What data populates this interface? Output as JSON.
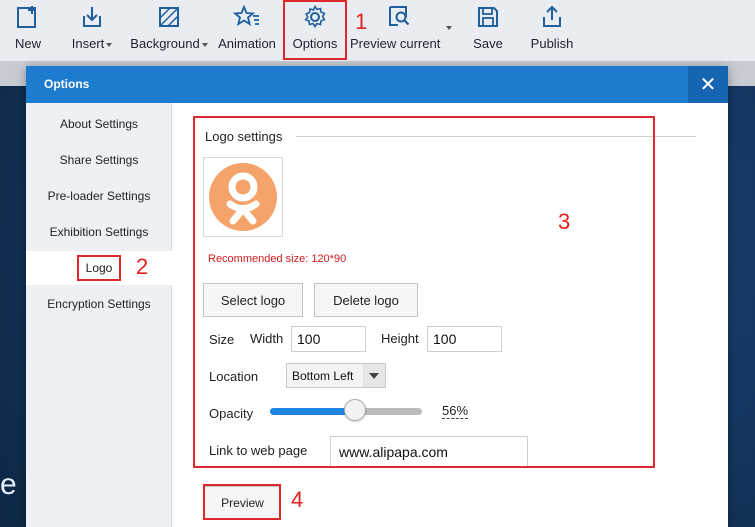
{
  "toolbar": {
    "items": [
      {
        "label": "New",
        "icon": "new-page-icon"
      },
      {
        "label": "Insert",
        "icon": "insert-icon",
        "dropdown": true
      },
      {
        "label": "Background",
        "icon": "background-icon",
        "dropdown": true
      },
      {
        "label": "Animation",
        "icon": "animation-icon"
      },
      {
        "label": "Options",
        "icon": "gear-icon"
      },
      {
        "label": "Preview current",
        "icon": "preview-search-icon",
        "dropdown": true
      },
      {
        "label": "Save",
        "icon": "save-icon"
      },
      {
        "label": "Publish",
        "icon": "publish-icon"
      }
    ]
  },
  "annotations": {
    "n1": "1",
    "n2": "2",
    "n3": "3",
    "n4": "4",
    "color": "#e0282c"
  },
  "dialog": {
    "title": "Options",
    "close_label": "✕",
    "header_color": "#1d7bd0"
  },
  "sidebar": {
    "items": [
      {
        "label": "About Settings"
      },
      {
        "label": "Share Settings"
      },
      {
        "label": "Pre-loader Settings"
      },
      {
        "label": "Exhibition Settings"
      },
      {
        "label": "Logo",
        "active": true
      },
      {
        "label": "Encryption Settings"
      }
    ]
  },
  "logo_settings": {
    "group_title": "Logo settings",
    "recommended": "Recommended size: 120*90",
    "select_label": "Select logo",
    "delete_label": "Delete logo",
    "size_label": "Size",
    "width_label": "Width",
    "width_value": "100",
    "height_label": "Height",
    "height_value": "100",
    "location_label": "Location",
    "location_value": "Bottom Left",
    "opacity_label": "Opacity",
    "opacity_value": 56,
    "opacity_text": "56%",
    "link_label": "Link to web page",
    "link_value": "www.alipapa.com",
    "logo_color": "#f4a46a"
  },
  "preview_label": "Preview"
}
